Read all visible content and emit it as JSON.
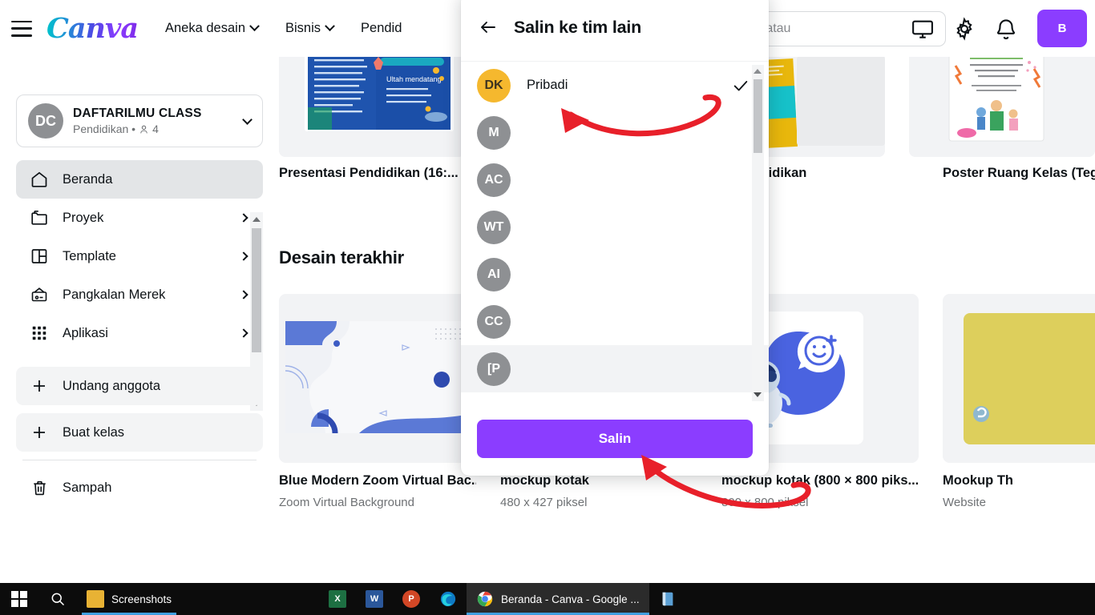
{
  "colors": {
    "brand_purple": "#8b3dff",
    "accent_yellow": "#f5b82e",
    "avatar_gray": "#8e9093",
    "annotation_red": "#e8202a",
    "sidebar_active": "#e3e5e7"
  },
  "topnav": {
    "menu_icon": "hamburger-icon",
    "brand": "Canva",
    "items": [
      {
        "label": "Aneka desain",
        "caret": true
      },
      {
        "label": "Bisnis",
        "caret": true
      },
      {
        "label": "Pendid",
        "caret": false
      }
    ],
    "search": {
      "value": "di konten Anda atau",
      "placeholder": "Telusuri konten Anda atau Canva"
    },
    "icons": [
      "monitor-icon",
      "gear-icon",
      "bell-icon"
    ],
    "cta_label": "B"
  },
  "sidebar": {
    "team": {
      "initials": "DC",
      "name": "DAFTARILMU CLASS",
      "subtitle": "Pendidikan •",
      "member_count": "4"
    },
    "items": [
      {
        "label": "Beranda",
        "icon": "home-icon",
        "active": true,
        "arrow": false
      },
      {
        "label": "Proyek",
        "icon": "folder-icon",
        "active": false,
        "arrow": true
      },
      {
        "label": "Template",
        "icon": "template-icon",
        "active": false,
        "arrow": true
      },
      {
        "label": "Pangkalan Merek",
        "icon": "brand-kit-icon",
        "active": false,
        "arrow": true
      },
      {
        "label": "Aplikasi",
        "icon": "apps-grid-icon",
        "active": false,
        "arrow": true
      }
    ],
    "actions": [
      {
        "label": "Undang anggota",
        "icon": "plus-icon"
      },
      {
        "label": "Buat kelas",
        "icon": "plus-icon"
      }
    ],
    "trash": {
      "label": "Sampah",
      "icon": "trash-icon"
    }
  },
  "main": {
    "templates": [
      {
        "title": "Presentasi Pendidikan (16:..."
      },
      {
        "title": ""
      },
      {
        "title": "is Pendidikan"
      },
      {
        "title": "Poster Ruang Kelas (Teg"
      }
    ],
    "section_title": "Desain terakhir",
    "designs": [
      {
        "title": "Blue Modern Zoom Virtual Bac...",
        "subtitle": "Zoom Virtual Background"
      },
      {
        "title": "mockup kotak",
        "subtitle": "480 x 427 piksel"
      },
      {
        "title": "mockup kotak (800 × 800 piks...",
        "subtitle": "800 x 800 piksel"
      },
      {
        "title": "Mookup Th",
        "subtitle": "Website"
      }
    ]
  },
  "modal": {
    "back_icon": "back-arrow-icon",
    "title": "Salin ke tim lain",
    "teams": [
      {
        "initials": "DK",
        "name": "Pribadi",
        "color": "#f5b82e",
        "text_color": "#3d3420",
        "selected": true,
        "highlight": false
      },
      {
        "initials": "M",
        "name": "",
        "color": "#8e9093",
        "text_color": "#ffffff",
        "selected": false,
        "highlight": false
      },
      {
        "initials": "AC",
        "name": "",
        "color": "#8e9093",
        "text_color": "#ffffff",
        "selected": false,
        "highlight": false
      },
      {
        "initials": "WT",
        "name": "",
        "color": "#8e9093",
        "text_color": "#ffffff",
        "selected": false,
        "highlight": false
      },
      {
        "initials": "AI",
        "name": "",
        "color": "#8e9093",
        "text_color": "#ffffff",
        "selected": false,
        "highlight": false
      },
      {
        "initials": "CC",
        "name": "",
        "color": "#8e9093",
        "text_color": "#ffffff",
        "selected": false,
        "highlight": false
      },
      {
        "initials": "[P",
        "name": "",
        "color": "#8e9093",
        "text_color": "#ffffff",
        "selected": false,
        "highlight": true
      }
    ],
    "confirm_label": "Salin"
  },
  "taskbar": {
    "start_icon": "windows-start-icon",
    "search_icon": "search-icon",
    "apps": [
      {
        "label": "Screenshots",
        "icon": "folder-icon",
        "color": "#e8b234",
        "open": false,
        "underline": true
      },
      {
        "label": "",
        "icon": "excel-icon",
        "color": "#1d6f42",
        "open": false,
        "underline": false
      },
      {
        "label": "",
        "icon": "word-icon",
        "color": "#2b579a",
        "open": false,
        "underline": false
      },
      {
        "label": "",
        "icon": "powerpoint-icon",
        "color": "#d24726",
        "open": false,
        "underline": false
      },
      {
        "label": "",
        "icon": "edge-icon",
        "color": "#0e7ac4",
        "open": false,
        "underline": false
      },
      {
        "label": "Beranda - Canva - Google ...",
        "icon": "chrome-icon",
        "color": "#ffffff",
        "open": true,
        "underline": false
      },
      {
        "label": "",
        "icon": "book-icon",
        "color": "#4a90c4",
        "open": false,
        "underline": false
      }
    ]
  }
}
